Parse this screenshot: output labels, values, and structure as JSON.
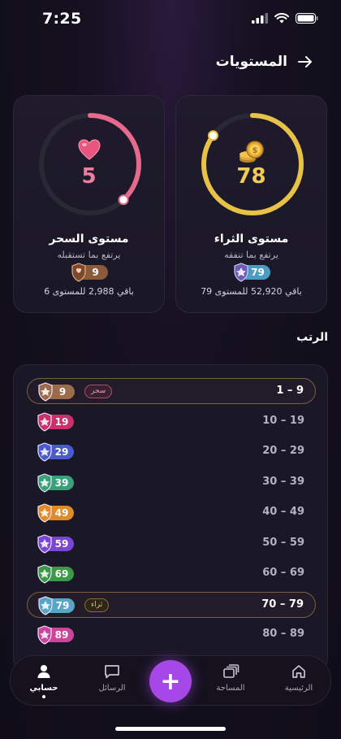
{
  "status": {
    "time": "7:25"
  },
  "header": {
    "title": "المستويات"
  },
  "cards": {
    "wealth": {
      "value": "78",
      "name": "مستوى الثراء",
      "desc": "يرتفع بما تنفقه",
      "badge_level": "79",
      "remaining": "باقي 52,920 للمستوى 79",
      "progress": 0.85,
      "color": "#e8c246"
    },
    "magic": {
      "value": "5",
      "name": "مستوى السحر",
      "desc": "يرتفع بما تستقبله",
      "badge_level": "9",
      "remaining": "باقي 2,988 للمستوى 6",
      "progress": 0.38,
      "color": "#e56a8d"
    }
  },
  "ranks": {
    "title": "الرتب",
    "rows": [
      {
        "range": "1 – 9",
        "badge": "9",
        "color": "#9b6b4a",
        "tag": "سحر",
        "highlight": true
      },
      {
        "range": "10 – 19",
        "badge": "19",
        "color": "#c9316d"
      },
      {
        "range": "20 – 29",
        "badge": "29",
        "color": "#4a5bd0"
      },
      {
        "range": "30 – 39",
        "badge": "39",
        "color": "#3aa07a"
      },
      {
        "range": "40 – 49",
        "badge": "49",
        "color": "#e08a2a"
      },
      {
        "range": "50 – 59",
        "badge": "59",
        "color": "#7b46d6"
      },
      {
        "range": "60 – 69",
        "badge": "69",
        "color": "#3a9a48"
      },
      {
        "range": "70 – 79",
        "badge": "79",
        "color": "#58a6c6",
        "tag": "ثراء",
        "highlight": true
      },
      {
        "range": "80 – 89",
        "badge": "89",
        "color": "#c9469c"
      }
    ]
  },
  "nav": {
    "home": "الرئيسية",
    "space": "المساحة",
    "add": "+",
    "messages": "الرسائل",
    "account": "حسابي"
  }
}
